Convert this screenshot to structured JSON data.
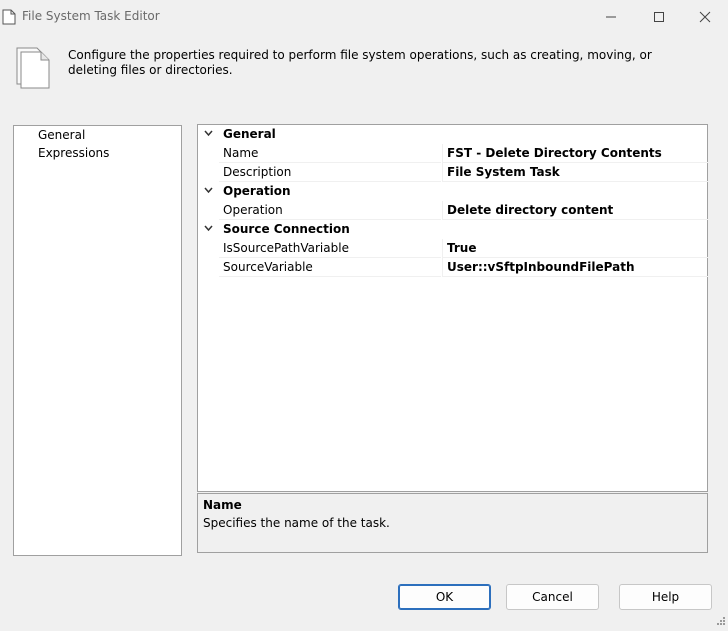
{
  "window": {
    "title": "File System Task Editor"
  },
  "header": {
    "icon": "document-stack-icon",
    "text": "Configure the properties required to perform file system operations, such as creating, moving, or deleting files or directories."
  },
  "nav": {
    "items": [
      {
        "label": "General"
      },
      {
        "label": "Expressions"
      }
    ]
  },
  "grid": {
    "categories": [
      {
        "label": "General",
        "props": [
          {
            "name": "Name",
            "value": "FST - Delete Directory Contents"
          },
          {
            "name": "Description",
            "value": "File System Task"
          }
        ]
      },
      {
        "label": "Operation",
        "props": [
          {
            "name": "Operation",
            "value": "Delete directory content"
          }
        ]
      },
      {
        "label": "Source Connection",
        "props": [
          {
            "name": "IsSourcePathVariable",
            "value": "True"
          },
          {
            "name": "SourceVariable",
            "value": "User::vSftpInboundFilePath"
          }
        ]
      }
    ]
  },
  "description": {
    "title": "Name",
    "body": "Specifies the name of the task."
  },
  "buttons": {
    "ok": "OK",
    "cancel": "Cancel",
    "help": "Help"
  },
  "colors": {
    "button_focus_border": "#2c6fbd",
    "panel_border": "#a0a0a0",
    "background": "#f0f0f0"
  }
}
